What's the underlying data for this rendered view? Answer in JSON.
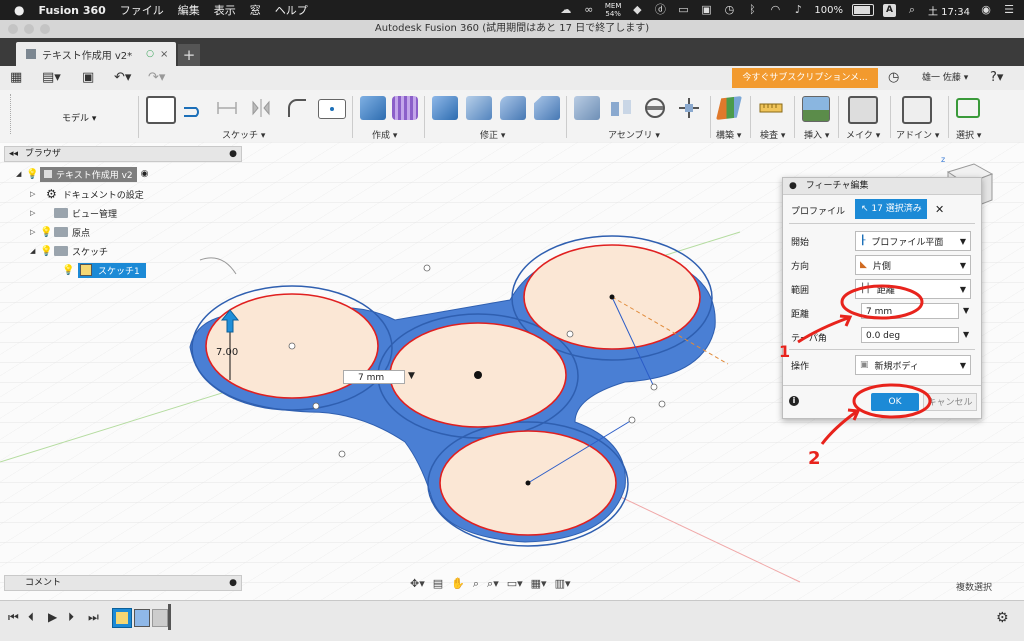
{
  "menubar": {
    "app_name": "Fusion 360",
    "menus": [
      "ファイル",
      "編集",
      "表示",
      "窓",
      "ヘルプ"
    ],
    "mem_label": "MEM",
    "mem_value": "54%",
    "battery": "100%",
    "ime": "A",
    "time": "土 17:34"
  },
  "window": {
    "title": "Autodesk Fusion 360 (試用期間はあと 17 日で終了します)"
  },
  "tab": {
    "title": "テキスト作成用 v2*"
  },
  "quickbar": {
    "subscription_label": "今すぐサブスクリプションメ...",
    "user_name": "雄一 佐藤"
  },
  "ribbon": {
    "workspace": "モデル",
    "groups": [
      "スケッチ",
      "作成",
      "修正",
      "アセンブリ",
      "構築",
      "検査",
      "挿入",
      "メイク",
      "アドイン",
      "選択"
    ]
  },
  "browser": {
    "title": "ブラウザ",
    "root": "テキスト作成用 v2",
    "items": [
      "ドキュメントの設定",
      "ビュー管理",
      "原点",
      "スケッチ"
    ],
    "sketch_item": "スケッチ1"
  },
  "canvas": {
    "dimension_height": "7.00",
    "distance_input": "7 mm"
  },
  "dialog": {
    "title": "フィーチャ編集",
    "profile_label": "プロファイル",
    "profile_value": "17 選択済み",
    "start_label": "開始",
    "start_value": "プロファイル平面",
    "direction_label": "方向",
    "direction_value": "片側",
    "extent_label": "範囲",
    "extent_value": "距離",
    "distance_label": "距離",
    "distance_value": "7 mm",
    "taper_label": "テーパ角",
    "taper_value": "0.0 deg",
    "operation_label": "操作",
    "operation_value": "新規ボディ",
    "ok_label": "OK",
    "cancel_label": "キャンセル"
  },
  "annotations": {
    "step1": "1",
    "step2": "2"
  },
  "bottom": {
    "comment_label": "コメント",
    "multi_select": "複数選択"
  },
  "colors": {
    "accent_blue": "#1c8ad6",
    "body_blue": "#4a7fd4",
    "profile_fill": "#fbe7d5",
    "sketch_red": "#e02020",
    "subscription_orange": "#f29a2e",
    "annotation_red": "#e8231c"
  }
}
